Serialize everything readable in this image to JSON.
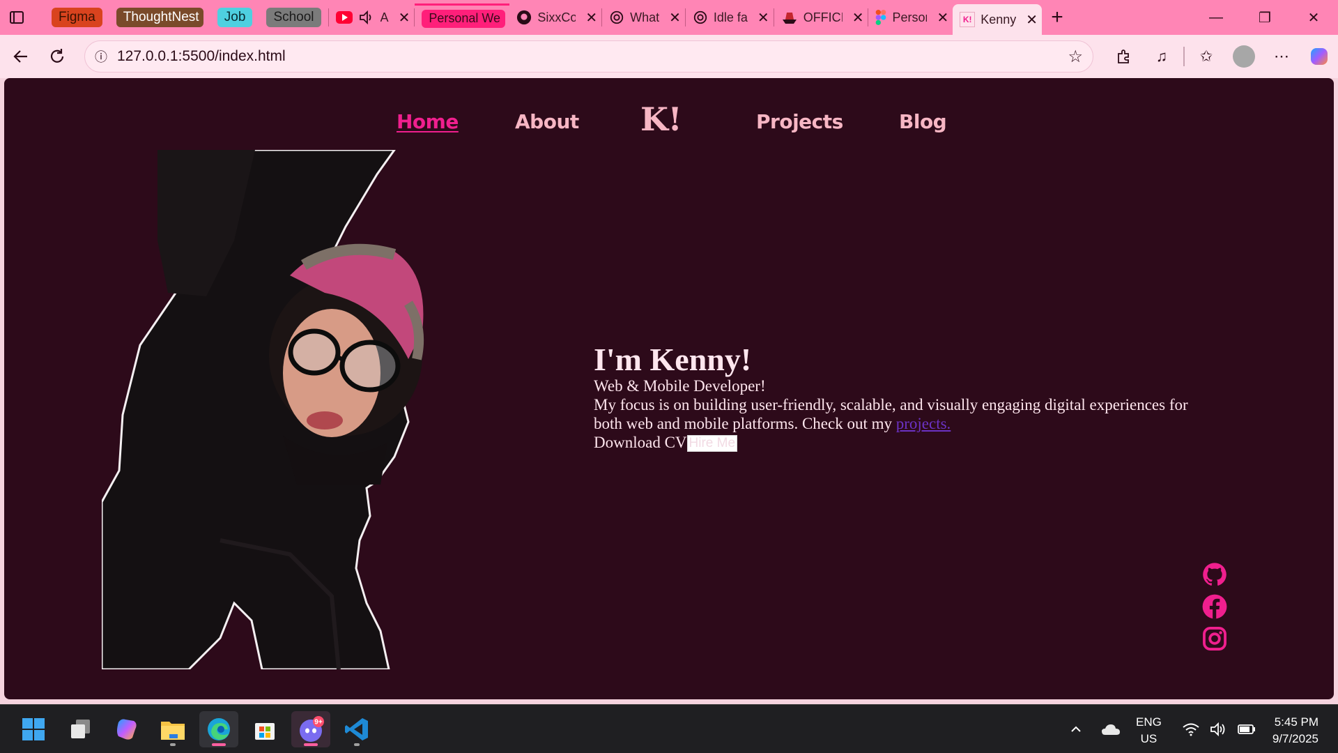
{
  "browser": {
    "tab_groups": [
      {
        "label": "Figma",
        "color": "#d9431e",
        "text_color": "#3a1200"
      },
      {
        "label": "ThoughtNest",
        "color": "#7a4a2a",
        "text_color": "#ffffff"
      },
      {
        "label": "Job",
        "color": "#4ed0e0",
        "text_color": "#0a2a30"
      },
      {
        "label": "School",
        "color": "#7b7b7b",
        "text_color": "#1b1b1b"
      }
    ],
    "tabs": [
      {
        "title": "A",
        "icon": "youtube-icon"
      },
      {
        "title": "Personal We",
        "icon": "group-chip-pink"
      },
      {
        "title": "SixxCo",
        "icon": "github-icon"
      },
      {
        "title": "What",
        "icon": "chatgpt-icon"
      },
      {
        "title": "Idle fa",
        "icon": "chatgpt-icon"
      },
      {
        "title": "OFFICI",
        "icon": "ship-icon"
      },
      {
        "title": "Person",
        "icon": "figma-icon"
      },
      {
        "title": "Kenny",
        "icon": "k-logo-icon",
        "active": true
      }
    ],
    "url": "127.0.0.1:5500/index.html"
  },
  "site": {
    "nav": {
      "home": "Home",
      "about": "About",
      "logo": "K!",
      "projects": "Projects",
      "blog": "Blog"
    },
    "hero": {
      "heading": "I'm Kenny!",
      "subtitle": "Web & Mobile Developer!",
      "description": "My focus is on building user-friendly, scalable, and visually engaging digital experiences for both web and mobile platforms. Check out my",
      "projects_link": "projects.",
      "download_cv": "Download CV",
      "hire_me": "Hire Me"
    },
    "socials": [
      "github-icon",
      "facebook-icon",
      "instagram-icon"
    ],
    "colors": {
      "background": "#2d0a1a",
      "accent": "#f01f8e",
      "nav_text": "#f7b6c4"
    }
  },
  "taskbar": {
    "apps": [
      "windows-start-icon",
      "task-view-icon",
      "copilot-icon",
      "file-explorer-icon",
      "edge-icon",
      "microsoft-store-icon",
      "discord-icon",
      "vscode-icon"
    ],
    "discord_badge": "9+",
    "language": "ENG",
    "region": "US",
    "time": "5:45 PM",
    "date": "9/7/2025"
  }
}
